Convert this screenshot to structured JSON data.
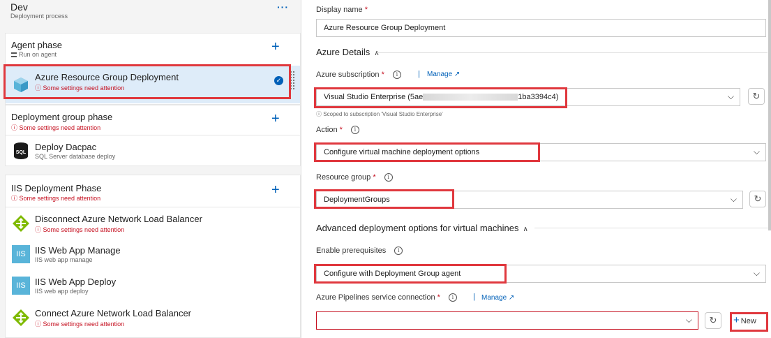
{
  "pipeline": {
    "name": "Dev",
    "subtitle": "Deployment process",
    "more_label": "···"
  },
  "agent_phase": {
    "title": "Agent phase",
    "subtitle": "Run on agent",
    "task": {
      "title": "Azure Resource Group Deployment",
      "warning": "Some settings need attention"
    }
  },
  "deployment_group_phase": {
    "title": "Deployment group phase",
    "warning": "Some settings need attention",
    "task": {
      "title": "Deploy Dacpac",
      "subtitle": "SQL Server database deploy",
      "icon_text": "SQL"
    }
  },
  "iis_phase": {
    "title": "IIS Deployment Phase",
    "warning": "Some settings need attention",
    "tasks": [
      {
        "title": "Disconnect Azure Network Load Balancer",
        "warning": "Some settings need attention"
      },
      {
        "title": "IIS Web App Manage",
        "subtitle": "IIS web app manage",
        "icon_text": "IIS"
      },
      {
        "title": "IIS Web App Deploy",
        "subtitle": "IIS web app deploy",
        "icon_text": "IIS"
      },
      {
        "title": "Connect Azure Network Load Balancer",
        "warning": "Some settings need attention"
      }
    ]
  },
  "form": {
    "display_name": {
      "label": "Display name",
      "value": "Azure Resource Group Deployment"
    },
    "azure_details": {
      "heading": "Azure Details"
    },
    "subscription": {
      "label": "Azure subscription",
      "manage": "Manage",
      "value_prefix": "Visual Studio Enterprise (5ae",
      "value_suffix": "1ba3394c4)",
      "scope_note": "Scoped to subscription 'Visual Studio Enterprise'"
    },
    "action": {
      "label": "Action",
      "value": "Configure virtual machine deployment options"
    },
    "resource_group": {
      "label": "Resource group",
      "value": "DeploymentGroups"
    },
    "advanced": {
      "heading": "Advanced deployment options for virtual machines"
    },
    "prerequisites": {
      "label": "Enable prerequisites",
      "value": "Configure with Deployment Group agent"
    },
    "service_connection": {
      "label": "Azure Pipelines service connection",
      "manage": "Manage",
      "value": "",
      "new_label": "New"
    }
  },
  "colors": {
    "accent": "#0060b8",
    "warning": "#c50f1f",
    "highlight": "#e0383e",
    "selected_bg": "#deecf9"
  }
}
